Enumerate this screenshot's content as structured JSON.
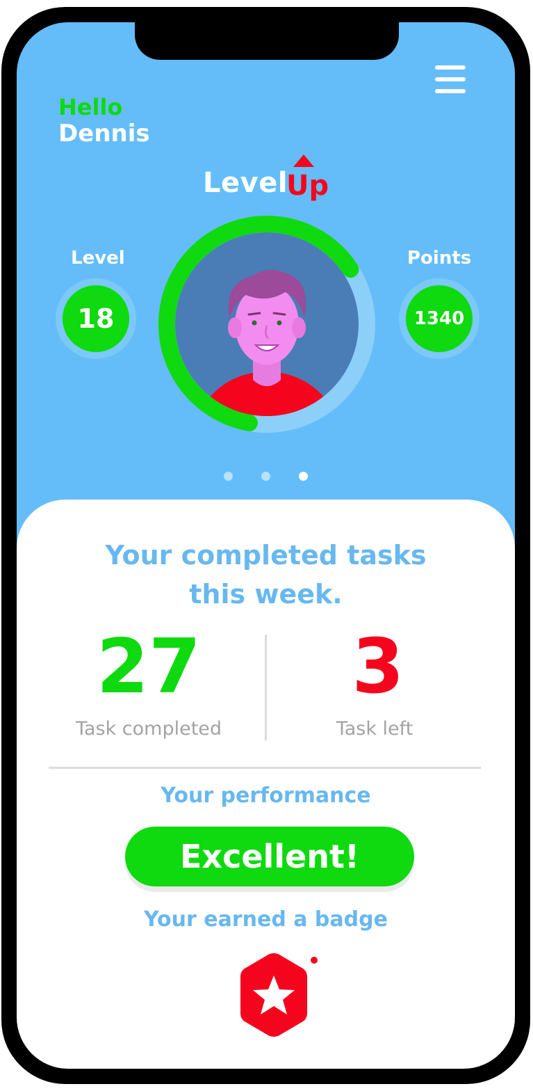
{
  "colors": {
    "sky": "#64bdf9",
    "avatar_bg": "#4a7db5",
    "green": "#0fd90f",
    "red": "#f5051d",
    "blue_text": "#68b8ef",
    "gray_text": "#a3a3a3",
    "ring_track": "#8ccff9"
  },
  "header": {
    "greeting": "Hello",
    "user_name": "Dennis",
    "logo_word": "Level",
    "logo_accent": "Up",
    "menu_icon": "hamburger-menu-icon"
  },
  "profile": {
    "level_label": "Level",
    "level_value": "18",
    "points_label": "Points",
    "points_value": "1340",
    "progress_fraction": 0.63
  },
  "carousel": {
    "pages": 3,
    "active_index": 2
  },
  "summary": {
    "title_line1": "Your completed tasks",
    "title_line2": "this week.",
    "completed_value": "27",
    "completed_label": "Task completed",
    "left_value": "3",
    "left_label": "Task left",
    "performance_label": "Your performance",
    "performance_value": "Excellent!",
    "badge_label": "Your earned a badge",
    "badge_icon": "star-badge-icon"
  }
}
